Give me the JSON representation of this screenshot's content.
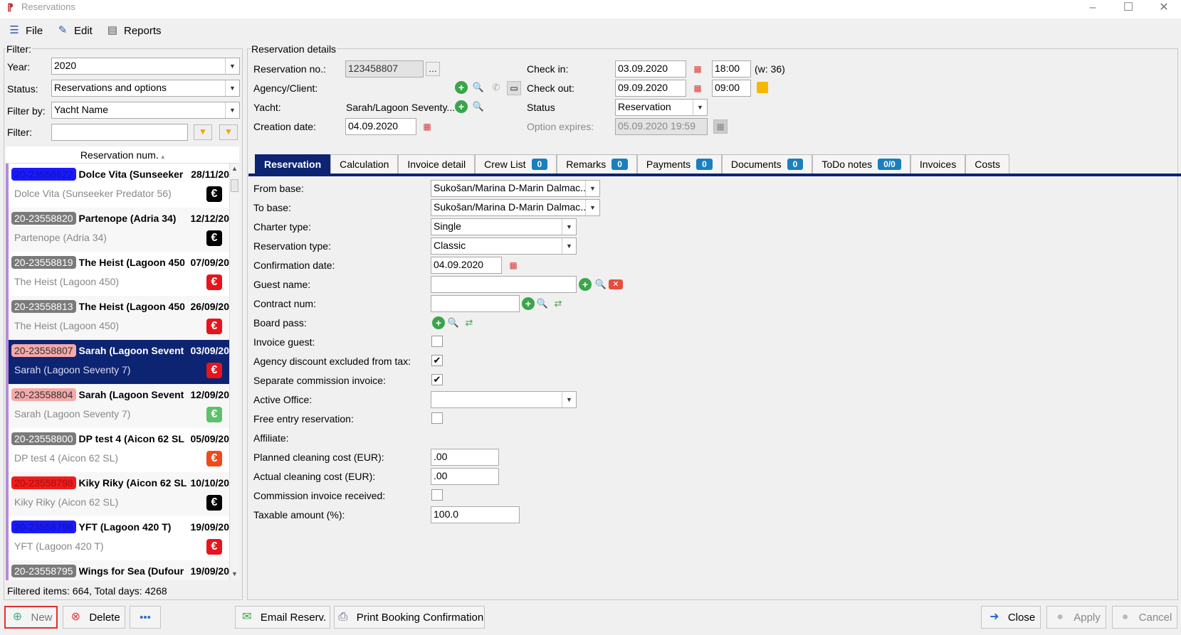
{
  "window": {
    "title": "Reservations"
  },
  "menu": [
    {
      "label": "File"
    },
    {
      "label": "Edit"
    },
    {
      "label": "Reports"
    }
  ],
  "filter": {
    "group": "Filter:",
    "year_label": "Year:",
    "year": "2020",
    "status_label": "Status:",
    "status": "Reservations and options",
    "filterby_label": "Filter by:",
    "filterby": "Yacht Name",
    "filter_label": "Filter:",
    "filter_value": ""
  },
  "list": {
    "header": "Reservation num.",
    "footer": "Filtered items: 664, Total days: 4268",
    "rows": [
      {
        "num": "20-23558822",
        "name": "Dolce Vita (Sunseeker",
        "date": "28/11/20",
        "sub": "Dolce Vita (Sunseeker Predator 56)",
        "numcolor": "#1a1aff",
        "numtext": "#1a1aff",
        "eurcolor": "#000"
      },
      {
        "num": "20-23558820",
        "name": "Partenope (Adria 34)",
        "date": "12/12/20",
        "sub": "Partenope (Adria 34)",
        "numcolor": "#7a7a7a",
        "numtext": "#fff",
        "eurcolor": "#000"
      },
      {
        "num": "20-23558819",
        "name": "The Heist (Lagoon 450",
        "date": "07/09/20",
        "sub": "The Heist (Lagoon 450)",
        "numcolor": "#7a7a7a",
        "numtext": "#fff",
        "eurcolor": "#e8141c"
      },
      {
        "num": "20-23558813",
        "name": "The Heist (Lagoon 450",
        "date": "26/09/20",
        "sub": "The Heist (Lagoon 450)",
        "numcolor": "#7a7a7a",
        "numtext": "#fff",
        "eurcolor": "#e8141c"
      },
      {
        "num": "20-23558807",
        "name": "Sarah (Lagoon Sevent",
        "date": "03/09/20",
        "sub": "Sarah (Lagoon Seventy 7)",
        "numcolor": "#f5a9a9",
        "numtext": "#333",
        "eurcolor": "#e8141c",
        "selected": true
      },
      {
        "num": "20-23558804",
        "name": "Sarah (Lagoon Sevent",
        "date": "12/09/20",
        "sub": "Sarah (Lagoon Seventy 7)",
        "numcolor": "#f5a9a9",
        "numtext": "#333",
        "eurcolor": "#5cc26a"
      },
      {
        "num": "20-23558800",
        "name": "DP test 4 (Aicon 62 SL",
        "date": "05/09/20",
        "sub": "DP test 4 (Aicon 62 SL)",
        "numcolor": "#7a7a7a",
        "numtext": "#fff",
        "eurcolor": "#f04a1a"
      },
      {
        "num": "20-23558798",
        "name": "Kiky Riky (Aicon 62 SL",
        "date": "10/10/20",
        "sub": "Kiky Riky (Aicon 62 SL)",
        "numcolor": "#f21b1b",
        "numtext": "#f21b1b",
        "eurcolor": "#000"
      },
      {
        "num": "20-23558796",
        "name": "YFT (Lagoon 420 T)",
        "date": "19/09/20",
        "sub": "YFT (Lagoon 420 T)",
        "numcolor": "#1a1aff",
        "numtext": "#1a1aff",
        "eurcolor": "#e8141c"
      },
      {
        "num": "20-23558795",
        "name": "Wings for Sea (Dufour",
        "date": "19/09/20",
        "sub": "",
        "numcolor": "#7a7a7a",
        "numtext": "#fff",
        "eurcolor": "#000"
      }
    ]
  },
  "details": {
    "group": "Reservation details",
    "resno_label": "Reservation no.:",
    "resno": "123458807",
    "agency_label": "Agency/Client:",
    "yacht_label": "Yacht:",
    "yacht": "Sarah/Lagoon Seventy...",
    "creation_label": "Creation date:",
    "creation": "04.09.2020",
    "checkin_label": "Check in:",
    "checkin_date": "03.09.2020",
    "checkin_time": "18:00",
    "week": "(w: 36)",
    "checkout_label": "Check out:",
    "checkout_date": "09.09.2020",
    "checkout_time": "09:00",
    "status_label": "Status",
    "status": "Reservation",
    "option_label": "Option expires:",
    "option": "05.09.2020 19:59"
  },
  "tabs": [
    {
      "label": "Reservation"
    },
    {
      "label": "Calculation"
    },
    {
      "label": "Invoice detail"
    },
    {
      "label": "Crew List",
      "badge": "0"
    },
    {
      "label": "Remarks",
      "badge": "0"
    },
    {
      "label": "Payments",
      "badge": "0"
    },
    {
      "label": "Documents",
      "badge": "0"
    },
    {
      "label": "ToDo notes",
      "badge": "0/0"
    },
    {
      "label": "Invoices"
    },
    {
      "label": "Costs"
    }
  ],
  "form": {
    "from_base_label": "From base:",
    "from_base": "Sukošan/Marina D-Marin Dalmac...",
    "to_base_label": "To base:",
    "to_base": "Sukošan/Marina D-Marin Dalmac...",
    "charter_type_label": "Charter type:",
    "charter_type": "Single",
    "reservation_type_label": "Reservation type:",
    "reservation_type": "Classic",
    "confirmation_label": "Confirmation date:",
    "confirmation": "04.09.2020",
    "guest_label": "Guest name:",
    "contract_label": "Contract num:",
    "board_label": "Board pass:",
    "invoice_guest_label": "Invoice guest:",
    "agency_discount_label": "Agency discount excluded from tax:",
    "separate_label": "Separate commission invoice:",
    "active_office_label": "Active Office:",
    "free_entry_label": "Free entry reservation:",
    "affiliate_label": "Affiliate:",
    "planned_label": "Planned cleaning cost (EUR):",
    "planned": ".00",
    "actual_label": "Actual cleaning cost (EUR):",
    "actual": ".00",
    "commission_label": "Commission invoice received:",
    "taxable_label": "Taxable amount (%):",
    "taxable": "100.0",
    "checks": {
      "invoice_guest": false,
      "agency_discount": true,
      "separate": true,
      "free_entry": false,
      "commission": false
    }
  },
  "buttons": {
    "new": "New",
    "delete": "Delete",
    "more": "•••",
    "email": "Email Reserv.",
    "print": "Print Booking Confirmation",
    "close": "Close",
    "apply": "Apply",
    "cancel": "Cancel"
  }
}
